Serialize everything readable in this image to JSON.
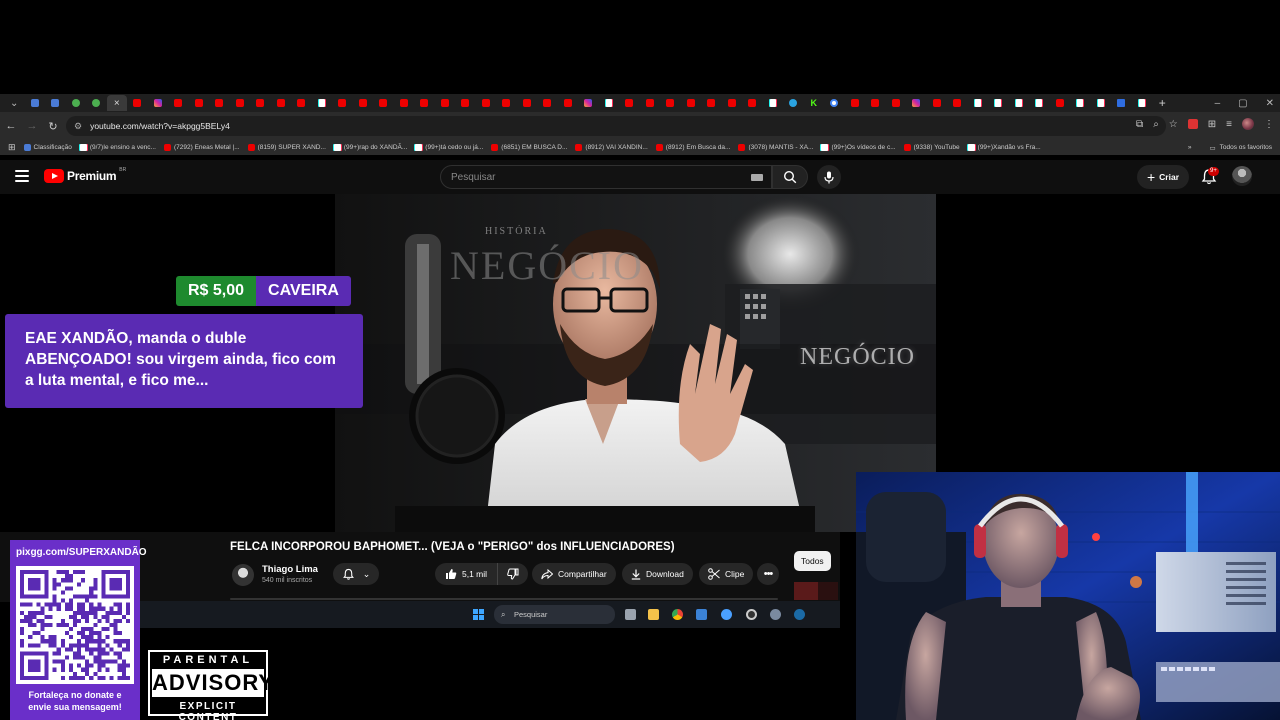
{
  "browser": {
    "tabs": [
      "grid",
      "yt-blue",
      "green",
      "green",
      "active",
      "yt",
      "ig",
      "yt",
      "yt",
      "yt",
      "yt",
      "yt",
      "yt",
      "yt",
      "tk",
      "yt",
      "yt",
      "yt",
      "yt",
      "yt",
      "yt",
      "yt",
      "yt",
      "yt",
      "yt",
      "yt",
      "yt",
      "ig",
      "tk",
      "yt",
      "yt",
      "yt",
      "yt",
      "yt",
      "yt",
      "yt",
      "tk",
      "tg",
      "kk",
      "gg",
      "yt",
      "yt",
      "yt",
      "ig",
      "yt",
      "yt",
      "tk",
      "tk",
      "tk",
      "tk",
      "yt",
      "tk",
      "tk",
      "tw",
      "tk"
    ],
    "new_tab": "+",
    "active_tab_close": "×",
    "url": "youtube.com/watch?v=akpgg5BELy4",
    "bookmarks": [
      {
        "icon": "bl",
        "label": "Classificação"
      },
      {
        "icon": "tk",
        "label": "(9/7)Ie ensino a venc..."
      },
      {
        "icon": "yt",
        "label": "(7292) Eneas Metal |..."
      },
      {
        "icon": "yt",
        "label": "(8159) SUPER XAND..."
      },
      {
        "icon": "tk",
        "label": "(99+)rap do XANDÃ..."
      },
      {
        "icon": "tk",
        "label": "(99+)tá cedo ou já..."
      },
      {
        "icon": "yt",
        "label": "(6851) EM BUSCA D..."
      },
      {
        "icon": "yt",
        "label": "(8912) VAI XANDIN..."
      },
      {
        "icon": "yt",
        "label": "(8912) Em Busca da..."
      },
      {
        "icon": "yt",
        "label": "(3078) MANTIS - XA..."
      },
      {
        "icon": "tk",
        "label": "(99+)Os vídeos de c..."
      },
      {
        "icon": "yt",
        "label": "(9338) YouTube"
      },
      {
        "icon": "tk",
        "label": "(99+)Xandão vs Fra..."
      }
    ],
    "all_favorites": "Todos os favoritos"
  },
  "youtube": {
    "logo": "Premium",
    "country": "BR",
    "search_placeholder": "Pesquisar",
    "create_label": "Criar",
    "notif_badge": "9+",
    "video": {
      "overlay_title": "NEGÓCIO",
      "overlay_small": "HISTÓRIA",
      "neon_sign": "NEGÓCIO"
    },
    "title": "FELCA INCORPOROU BAPHOMET... (VEJA o \"PERIGO\" dos INFLUENCIADORES)",
    "channel": "Thiago Lima",
    "subscribers": "540 mil inscritos",
    "likes": "5,1 mil",
    "share": "Compartilhar",
    "download": "Download",
    "clip": "Clipe",
    "filter_chip": "Todos"
  },
  "donation": {
    "amount": "R$ 5,00",
    "donor": "CAVEIRA",
    "message": "EAE XANDÃO, manda o duble ABENÇOADO! sou virgem ainda, fico com a luta mental, e fico me..."
  },
  "taskbar": {
    "search_placeholder": "Pesquisar"
  },
  "sponsor": {
    "url": "pixgg.com/SUPERXANDÃO",
    "caption_line1": "Fortaleça no donate e",
    "caption_line2": "envie sua mensagem!"
  },
  "advisory": {
    "top": "PARENTAL",
    "middle": "ADVISORY",
    "bottom": "EXPLICIT CONTENT"
  },
  "colors": {
    "donation_amount_bg": "#1e8a2e",
    "donation_purple": "#5a2bb3",
    "sponsor_purple": "#6a2fc9",
    "youtube_red": "#ff0000"
  }
}
